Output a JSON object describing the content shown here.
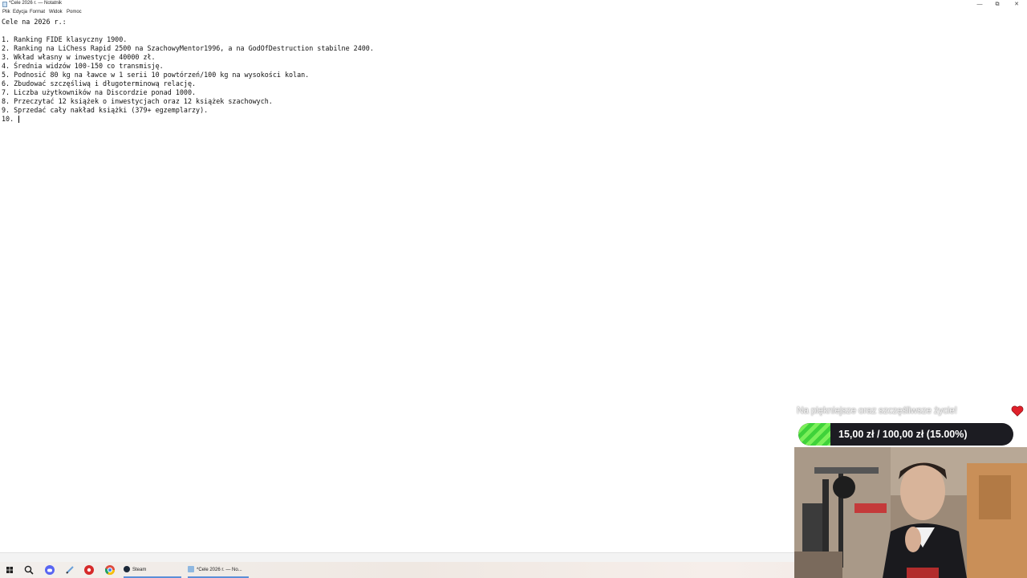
{
  "window": {
    "title": "*Cele 2026 r. — Notatnik",
    "controls": {
      "minimize": "—",
      "maximize": "⧉",
      "close": "✕"
    }
  },
  "menu": [
    "Plik",
    "Edycja",
    "Format",
    "Widok",
    "Pomoc"
  ],
  "editor": {
    "lines": [
      "Cele na 2026 r.:",
      "",
      "1. Ranking FIDE klasyczny 1900.",
      "2. Ranking na LiChess Rapid 2500 na SzachowyMentor1996, a na GodOfDestruction stabilne 2400.",
      "3. Wkład własny w inwestycje 40000 zł.",
      "4. Średnia widzów 100-150 co transmisję.",
      "5. Podnosić 80 kg na ławce w 1 serii 10 powtórzeń/100 kg na wysokości kolan.",
      "6. Zbudować szczęśliwą i długoterminową relację.",
      "7. Liczba użytkowników na Discordzie ponad 1000.",
      "8. Przeczytać 12 książek o inwestycjach oraz 12 książek szachowych.",
      "9. Sprzedać cały nakład książki (379+ egzemplarzy).",
      "10. "
    ]
  },
  "taskbar": {
    "icons": [
      "windows-start-icon",
      "search-icon",
      "discord-icon",
      "pen-icon",
      "red-app-icon",
      "chrome-icon"
    ],
    "tasks": [
      {
        "name": "steam-task",
        "label": "Steam"
      },
      {
        "name": "notepad-task",
        "label": "*Cele 2026 r. — No..."
      }
    ]
  },
  "overlay": {
    "goal_title": "Na piękniejsze oraz szczęśliwsze życie!",
    "goal_text": "15,00 zł / 100,00 zł (15.00%)",
    "goal_progress": 0.15,
    "colors": {
      "fill": "#3fd23a",
      "bar_bg": "#1c1c22",
      "heart": "#e0202a"
    }
  }
}
